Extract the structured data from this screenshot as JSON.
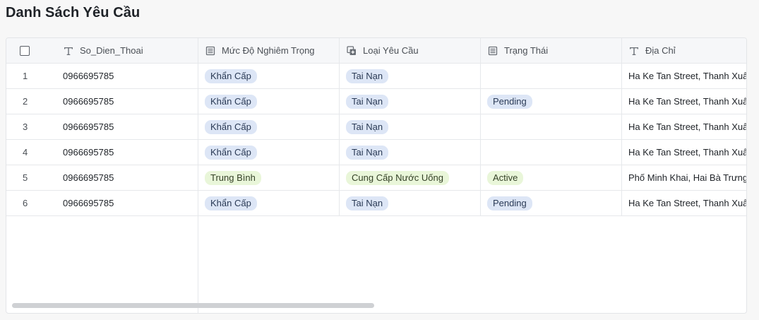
{
  "page": {
    "title": "Danh Sách Yêu Cầu"
  },
  "table": {
    "columns": [
      {
        "label": "So_Dien_Thoai",
        "icon": "text-type-icon"
      },
      {
        "label": "Mức Độ Nghiêm Trọng",
        "icon": "list-field-icon"
      },
      {
        "label": "Loại Yêu Cầu",
        "icon": "multi-select-icon"
      },
      {
        "label": "Trạng Thái",
        "icon": "list-field-icon"
      },
      {
        "label": "Địa Chỉ",
        "icon": "text-type-icon"
      }
    ],
    "rows": [
      {
        "num": "1",
        "phone": "0966695785",
        "severity": "Khẩn Cấp",
        "type": "Tai Nạn",
        "status": "",
        "address": "Ha Ke Tan Street, Thanh Xuâ..."
      },
      {
        "num": "2",
        "phone": "0966695785",
        "severity": "Khẩn Cấp",
        "type": "Tai Nạn",
        "status": "Pending",
        "address": "Ha Ke Tan Street, Thanh Xuâ..."
      },
      {
        "num": "3",
        "phone": "0966695785",
        "severity": "Khẩn Cấp",
        "type": "Tai Nạn",
        "status": "",
        "address": "Ha Ke Tan Street, Thanh Xuâ..."
      },
      {
        "num": "4",
        "phone": "0966695785",
        "severity": "Khẩn Cấp",
        "type": "Tai Nạn",
        "status": "",
        "address": "Ha Ke Tan Street, Thanh Xuâ..."
      },
      {
        "num": "5",
        "phone": "0966695785",
        "severity": "Trung Bình",
        "type": "Cung Cấp Nước Uống",
        "status": "Active",
        "address": "Phố Minh Khai, Hai Bà Trưng..."
      },
      {
        "num": "6",
        "phone": "0966695785",
        "severity": "Khẩn Cấp",
        "type": "Tai Nạn",
        "status": "Pending",
        "address": "Ha Ke Tan Street, Thanh Xuâ..."
      }
    ]
  },
  "colors": {
    "tag_blue": "#dde6f6",
    "tag_green": "#e9f6d9"
  }
}
